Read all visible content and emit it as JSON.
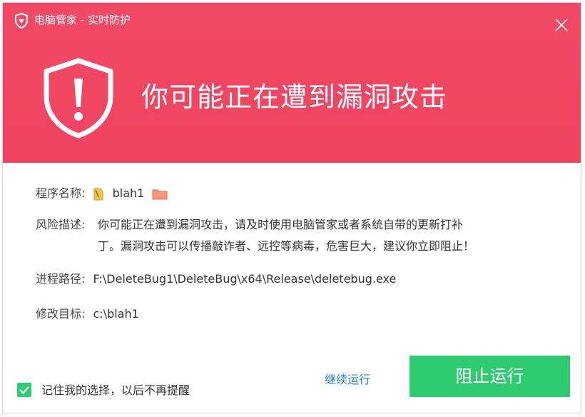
{
  "window": {
    "title": "电脑管家 - 实时防护"
  },
  "alert": {
    "headline": "你可能正在遭到漏洞攻击"
  },
  "details": {
    "program_label": "程序名称:",
    "program_value": "blah1",
    "risk_label": "风险描述:",
    "risk_line1": "你可能正在遭到漏洞攻击，请及时使用电脑管家或者系统自带的更新打补",
    "risk_line2": "丁。漏洞攻击可以传播敲诈者、远控等病毒，危害巨大，建议你立即阻止！",
    "path_label": "进程路径:",
    "path_value": "F:\\DeleteBug1\\DeleteBug\\x64\\Release\\deletebug.exe",
    "target_label": "修改目标:",
    "target_value": "c:\\blah1"
  },
  "actions": {
    "continue_label": "继续运行",
    "block_label": "阻止运行",
    "remember_label": "记住我的选择，以后不再提醒",
    "remember_checked": true
  },
  "colors": {
    "banner": "#f04763",
    "block_button": "#2ecb70",
    "link": "#2a7fd6"
  },
  "icons": [
    "shield-logo-icon",
    "close-icon",
    "warning-shield-icon",
    "file-icon",
    "folder-icon",
    "checkmark-icon"
  ]
}
